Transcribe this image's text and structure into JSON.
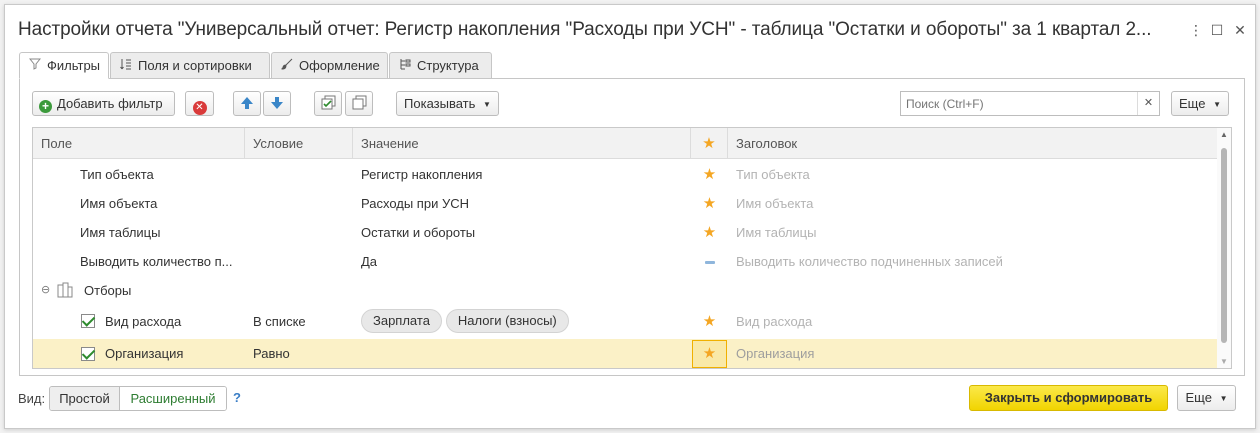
{
  "window": {
    "title": "Настройки отчета \"Универсальный отчет: Регистр накопления \"Расходы при УСН\" - таблица \"Остатки и обороты\" за 1 квартал 2...",
    "more_icon": "⋮",
    "maximize_icon": "☐",
    "close_icon": "✕"
  },
  "tabs": [
    {
      "label": "Фильтры",
      "icon": "filter-icon",
      "active": true
    },
    {
      "label": "Поля и сортировки",
      "icon": "fields-icon",
      "active": false
    },
    {
      "label": "Оформление",
      "icon": "brush-icon",
      "active": false
    },
    {
      "label": "Структура",
      "icon": "structure-icon",
      "active": false
    }
  ],
  "toolbar": {
    "add_filter_label": "Добавить фильтр",
    "show_label": "Показывать",
    "search_placeholder": "Поиск (Ctrl+F)",
    "search_value": "",
    "more_label": "Еще"
  },
  "grid": {
    "columns": {
      "field": "Поле",
      "condition": "Условие",
      "value": "Значение",
      "title": "Заголовок"
    },
    "rows": [
      {
        "field": "Тип объекта",
        "condition": "",
        "value": "Регистр накопления",
        "mark": "star",
        "title": "Тип объекта"
      },
      {
        "field": "Имя объекта",
        "condition": "",
        "value": "Расходы при УСН",
        "mark": "star",
        "title": "Имя объекта"
      },
      {
        "field": "Имя таблицы",
        "condition": "",
        "value": "Остатки и обороты",
        "mark": "star",
        "title": "Имя таблицы"
      },
      {
        "field": "Выводить количество п...",
        "condition": "",
        "value": "Да",
        "mark": "dash",
        "title": "Выводить количество подчиненных записей"
      }
    ],
    "group": {
      "label": "Отборы"
    },
    "filters": [
      {
        "field": "Вид расхода",
        "condition": "В списке",
        "chips": [
          "Зарплата",
          "Налоги (взносы)"
        ],
        "checked": true,
        "title": "Вид расхода"
      },
      {
        "field": "Организация",
        "condition": "Равно",
        "chips": [],
        "checked": true,
        "title": "Организация"
      }
    ]
  },
  "footer": {
    "view_label": "Вид:",
    "simple_label": "Простой",
    "extended_label": "Расширенный",
    "help_label": "?",
    "close_generate_label": "Закрыть и сформировать",
    "more_label": "Еще"
  },
  "colors": {
    "accent_yellow": "#f9e21b",
    "selected_row": "#fbf1c7",
    "star": "#f4a623",
    "extended_green": "#2e7d32"
  }
}
